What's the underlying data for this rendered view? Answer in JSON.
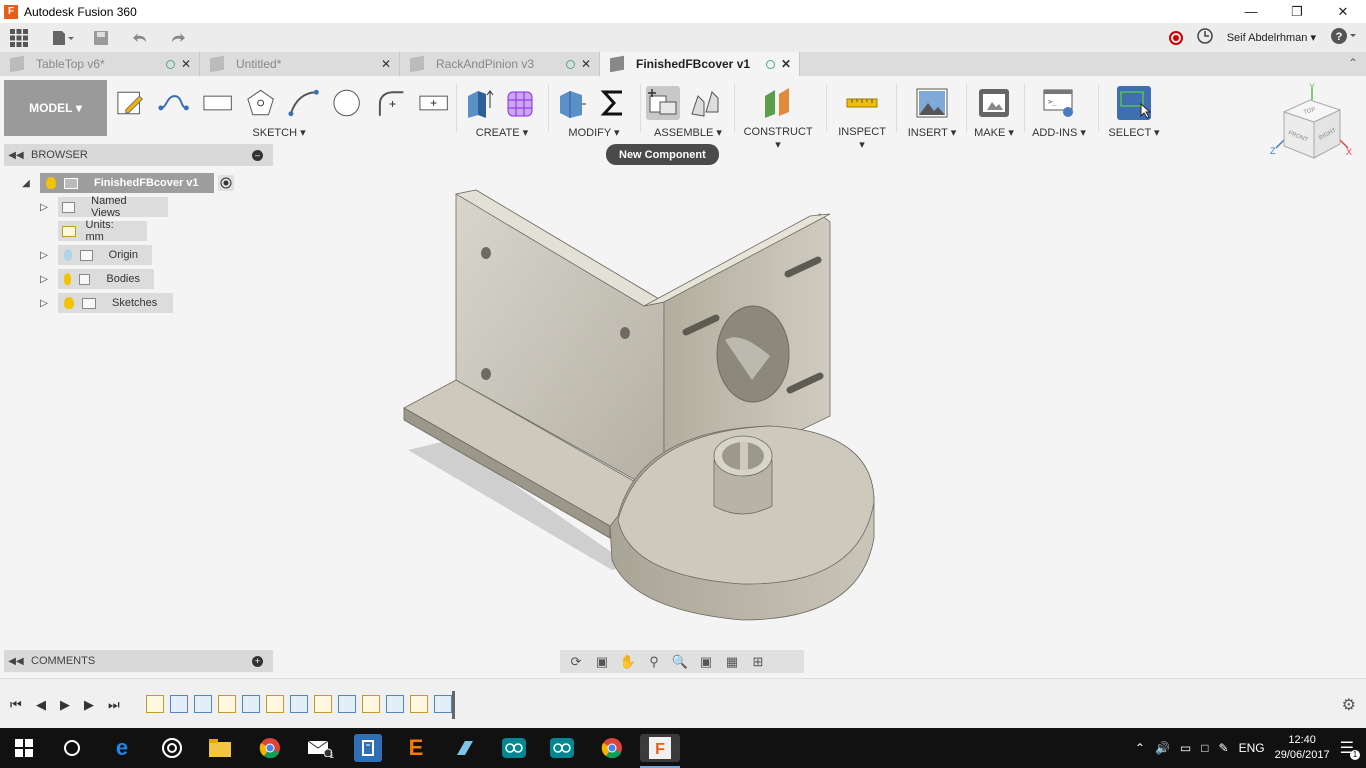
{
  "window": {
    "title": "Autodesk Fusion 360"
  },
  "user": {
    "name": "Seif Abdelrhman"
  },
  "tabs": [
    {
      "label": "TableTop v6*",
      "active": false
    },
    {
      "label": "Untitled*",
      "active": false
    },
    {
      "label": "RackAndPinion v3",
      "active": false
    },
    {
      "label": "FinishedFBcover v1",
      "active": true
    }
  ],
  "ribbon": {
    "workspace": "MODEL",
    "groups": {
      "sketch": "SKETCH",
      "create": "CREATE",
      "modify": "MODIFY",
      "assemble": "ASSEMBLE",
      "construct": "CONSTRUCT",
      "inspect": "INSPECT",
      "insert": "INSERT",
      "make": "MAKE",
      "addins": "ADD-INS",
      "select": "SELECT"
    }
  },
  "tooltip": "New Component",
  "browser": {
    "title": "BROWSER",
    "root": "FinishedFBcover v1",
    "items": [
      {
        "label": "Named Views"
      },
      {
        "label": "Units: mm"
      },
      {
        "label": "Origin"
      },
      {
        "label": "Bodies"
      },
      {
        "label": "Sketches"
      }
    ]
  },
  "comments": {
    "title": "COMMENTS"
  },
  "viewcube": {
    "top": "TOP",
    "front": "FRONT",
    "right": "RIGHT",
    "x": "X",
    "y": "Y",
    "z": "Z"
  },
  "taskbar": {
    "language": "ENG",
    "time": "12:40",
    "date": "29/06/2017",
    "mail_badge": "1",
    "notif_badge": "1"
  },
  "colors": {
    "accent_select": "#3f6fb0",
    "model_button": "#9a9a9a",
    "record": "#cc0000"
  }
}
